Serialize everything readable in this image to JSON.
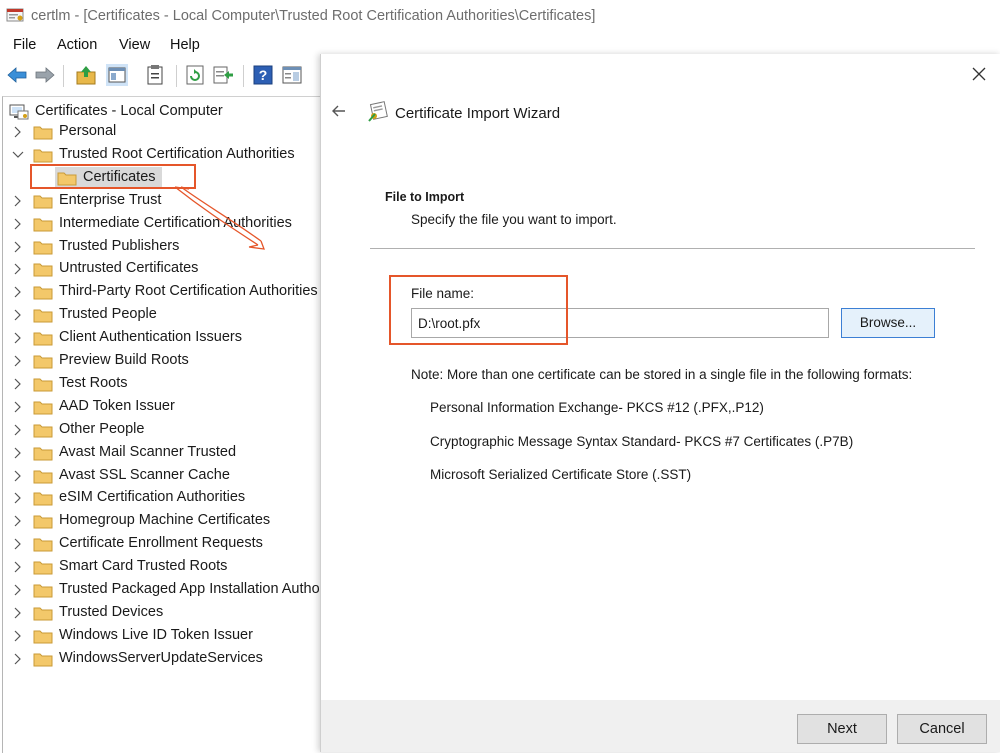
{
  "window": {
    "title": "certlm - [Certificates - Local Computer\\Trusted Root Certification Authorities\\Certificates]"
  },
  "menu": [
    "File",
    "Action",
    "View",
    "Help"
  ],
  "toolbar_icons": [
    "back-icon",
    "forward-icon",
    "up-folder-icon",
    "show-hide-console-tree-icon",
    "properties-icon",
    "refresh-icon",
    "export-list-icon",
    "help-icon",
    "action-pane-icon"
  ],
  "tree": {
    "root": "Certificates - Local Computer",
    "expanded_node": "Trusted Root Certification Authorities",
    "selected_child": "Certificates",
    "nodes": [
      "Personal",
      "Trusted Root Certification Authorities",
      "Enterprise Trust",
      "Intermediate Certification Authorities",
      "Trusted Publishers",
      "Untrusted Certificates",
      "Third-Party Root Certification Authorities",
      "Trusted People",
      "Client Authentication Issuers",
      "Preview Build Roots",
      "Test Roots",
      "AAD Token Issuer",
      "Other People",
      "Avast Mail Scanner Trusted",
      "Avast SSL Scanner Cache",
      "eSIM Certification Authorities",
      "Homegroup Machine Certificates",
      "Certificate Enrollment Requests",
      "Smart Card Trusted Roots",
      "Trusted Packaged App Installation Authorities",
      "Trusted Devices",
      "Windows Live ID Token Issuer",
      "WindowsServerUpdateServices"
    ]
  },
  "wizard": {
    "title": "Certificate Import Wizard",
    "section_heading": "File to Import",
    "section_subtitle": "Specify the file you want to import.",
    "file_name_label": "File name:",
    "file_name_value": "D:\\root.pfx",
    "browse_label": "Browse...",
    "note": "Note:  More than one certificate can be stored in a single file in the following formats:",
    "formats": [
      "Personal Information Exchange- PKCS #12 (.PFX,.P12)",
      "Cryptographic Message Syntax Standard- PKCS #7 Certificates (.P7B)",
      "Microsoft Serialized Certificate Store (.SST)"
    ],
    "next_label": "Next",
    "cancel_label": "Cancel"
  },
  "colors": {
    "annotation": "#e5562a",
    "folder": "#f3c86a",
    "browse_border": "#3c7fd4"
  }
}
